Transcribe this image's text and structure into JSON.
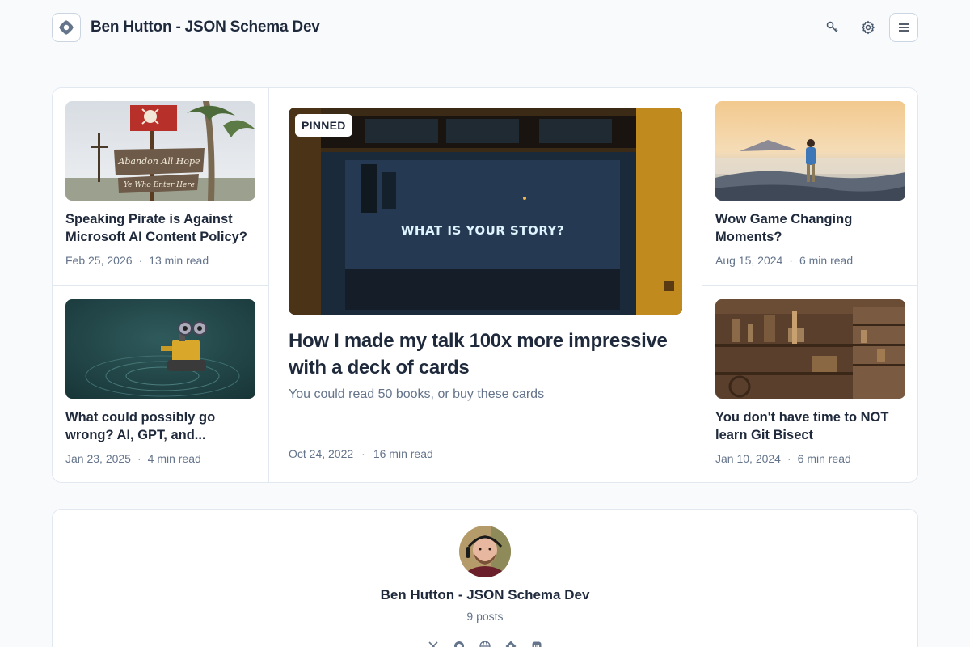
{
  "header": {
    "title": "Ben Hutton - JSON Schema Dev",
    "icons": [
      "logo-icon",
      "key-icon",
      "settings-icon",
      "menu-icon"
    ]
  },
  "posts": {
    "left": [
      {
        "title": "Speaking Pirate is Against Microsoft AI Content Policy?",
        "date": "Feb 25, 2026",
        "read": "13 min read",
        "sign_line1": "Abandon All Hope",
        "sign_line2": "Ye Who Enter Here"
      },
      {
        "title": "What could possibly go wrong? AI, GPT, and...",
        "date": "Jan 23, 2025",
        "read": "4 min read"
      }
    ],
    "featured": {
      "badge": "PINNED",
      "neon": "WHAT IS YOUR STORY?",
      "title": "How I made my talk 100x more impressive with a deck of cards",
      "subtitle": "You could read 50 books, or buy these cards",
      "date": "Oct 24, 2022",
      "read": "16 min read"
    },
    "right": [
      {
        "title": "Wow Game Changing Moments?",
        "date": "Aug 15, 2024",
        "read": "6 min read"
      },
      {
        "title": "You don't have time to NOT learn Git Bisect",
        "date": "Jan 10, 2024",
        "read": "6 min read"
      }
    ],
    "separator": "·"
  },
  "author": {
    "name": "Ben Hutton - JSON Schema Dev",
    "posts": "9 posts",
    "social_icons": [
      "x-icon",
      "github-icon",
      "globe-icon",
      "hashnode-icon",
      "mastodon-icon"
    ]
  },
  "colors": {
    "text": "#1e293b",
    "muted": "#64748b",
    "border": "#e2e8f0",
    "bg": "#f8fafc"
  }
}
